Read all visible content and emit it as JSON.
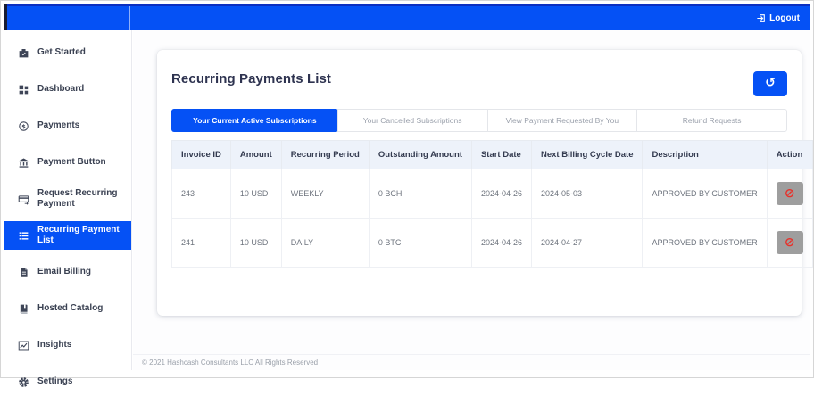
{
  "colors": {
    "accent": "#0551f5",
    "topbar_top_line": "#0c2fc0",
    "action_button_bg": "#9e9e9e",
    "action_icon_color": "#e8312a",
    "table_header_bg": "#edf2fa"
  },
  "icons": {
    "history": "↺",
    "cancel": "⊘"
  },
  "topbar": {
    "logout_label": "Logout"
  },
  "sidebar": {
    "items": [
      {
        "label": "Get Started",
        "icon": "get-started-icon",
        "active": false
      },
      {
        "label": "Dashboard",
        "icon": "dashboard-icon",
        "active": false
      },
      {
        "label": "Payments",
        "icon": "payments-icon",
        "active": false
      },
      {
        "label": "Payment Button",
        "icon": "payment-button-icon",
        "active": false
      },
      {
        "label": "Request Recurring Payment",
        "icon": "request-recurring-payment-icon",
        "active": false
      },
      {
        "label": "Recurring Payment List",
        "icon": "recurring-payment-list-icon",
        "active": true
      },
      {
        "label": "Email Billing",
        "icon": "email-billing-icon",
        "active": false
      },
      {
        "label": "Hosted Catalog",
        "icon": "hosted-catalog-icon",
        "active": false
      },
      {
        "label": "Insights",
        "icon": "insights-icon",
        "active": false
      },
      {
        "label": "Settings",
        "icon": "settings-icon",
        "active": false
      }
    ]
  },
  "main": {
    "title": "Recurring Payments List",
    "tabs": [
      {
        "label": "Your Current Active Subscriptions",
        "active": true
      },
      {
        "label": "Your Cancelled Subscriptions",
        "active": false
      },
      {
        "label": "View Payment Requested By You",
        "active": false
      },
      {
        "label": "Refund Requests",
        "active": false
      }
    ],
    "table": {
      "headers": [
        "Invoice ID",
        "Amount",
        "Recurring Period",
        "Outstanding Amount",
        "Start Date",
        "Next Billing Cycle Date",
        "Description",
        "Action"
      ],
      "rows": [
        {
          "invoice_id": "243",
          "amount": "10 USD",
          "recurring_period": "WEEKLY",
          "outstanding_amount": "0 BCH",
          "start_date": "2024-04-26",
          "next_billing_cycle_date": "2024-05-03",
          "description": "APPROVED BY CUSTOMER"
        },
        {
          "invoice_id": "241",
          "amount": "10 USD",
          "recurring_period": "DAILY",
          "outstanding_amount": "0 BTC",
          "start_date": "2024-04-26",
          "next_billing_cycle_date": "2024-04-27",
          "description": "APPROVED BY CUSTOMER"
        }
      ]
    }
  },
  "footer": {
    "text": "© 2021 Hashcash Consultants LLC All Rights Reserved"
  }
}
